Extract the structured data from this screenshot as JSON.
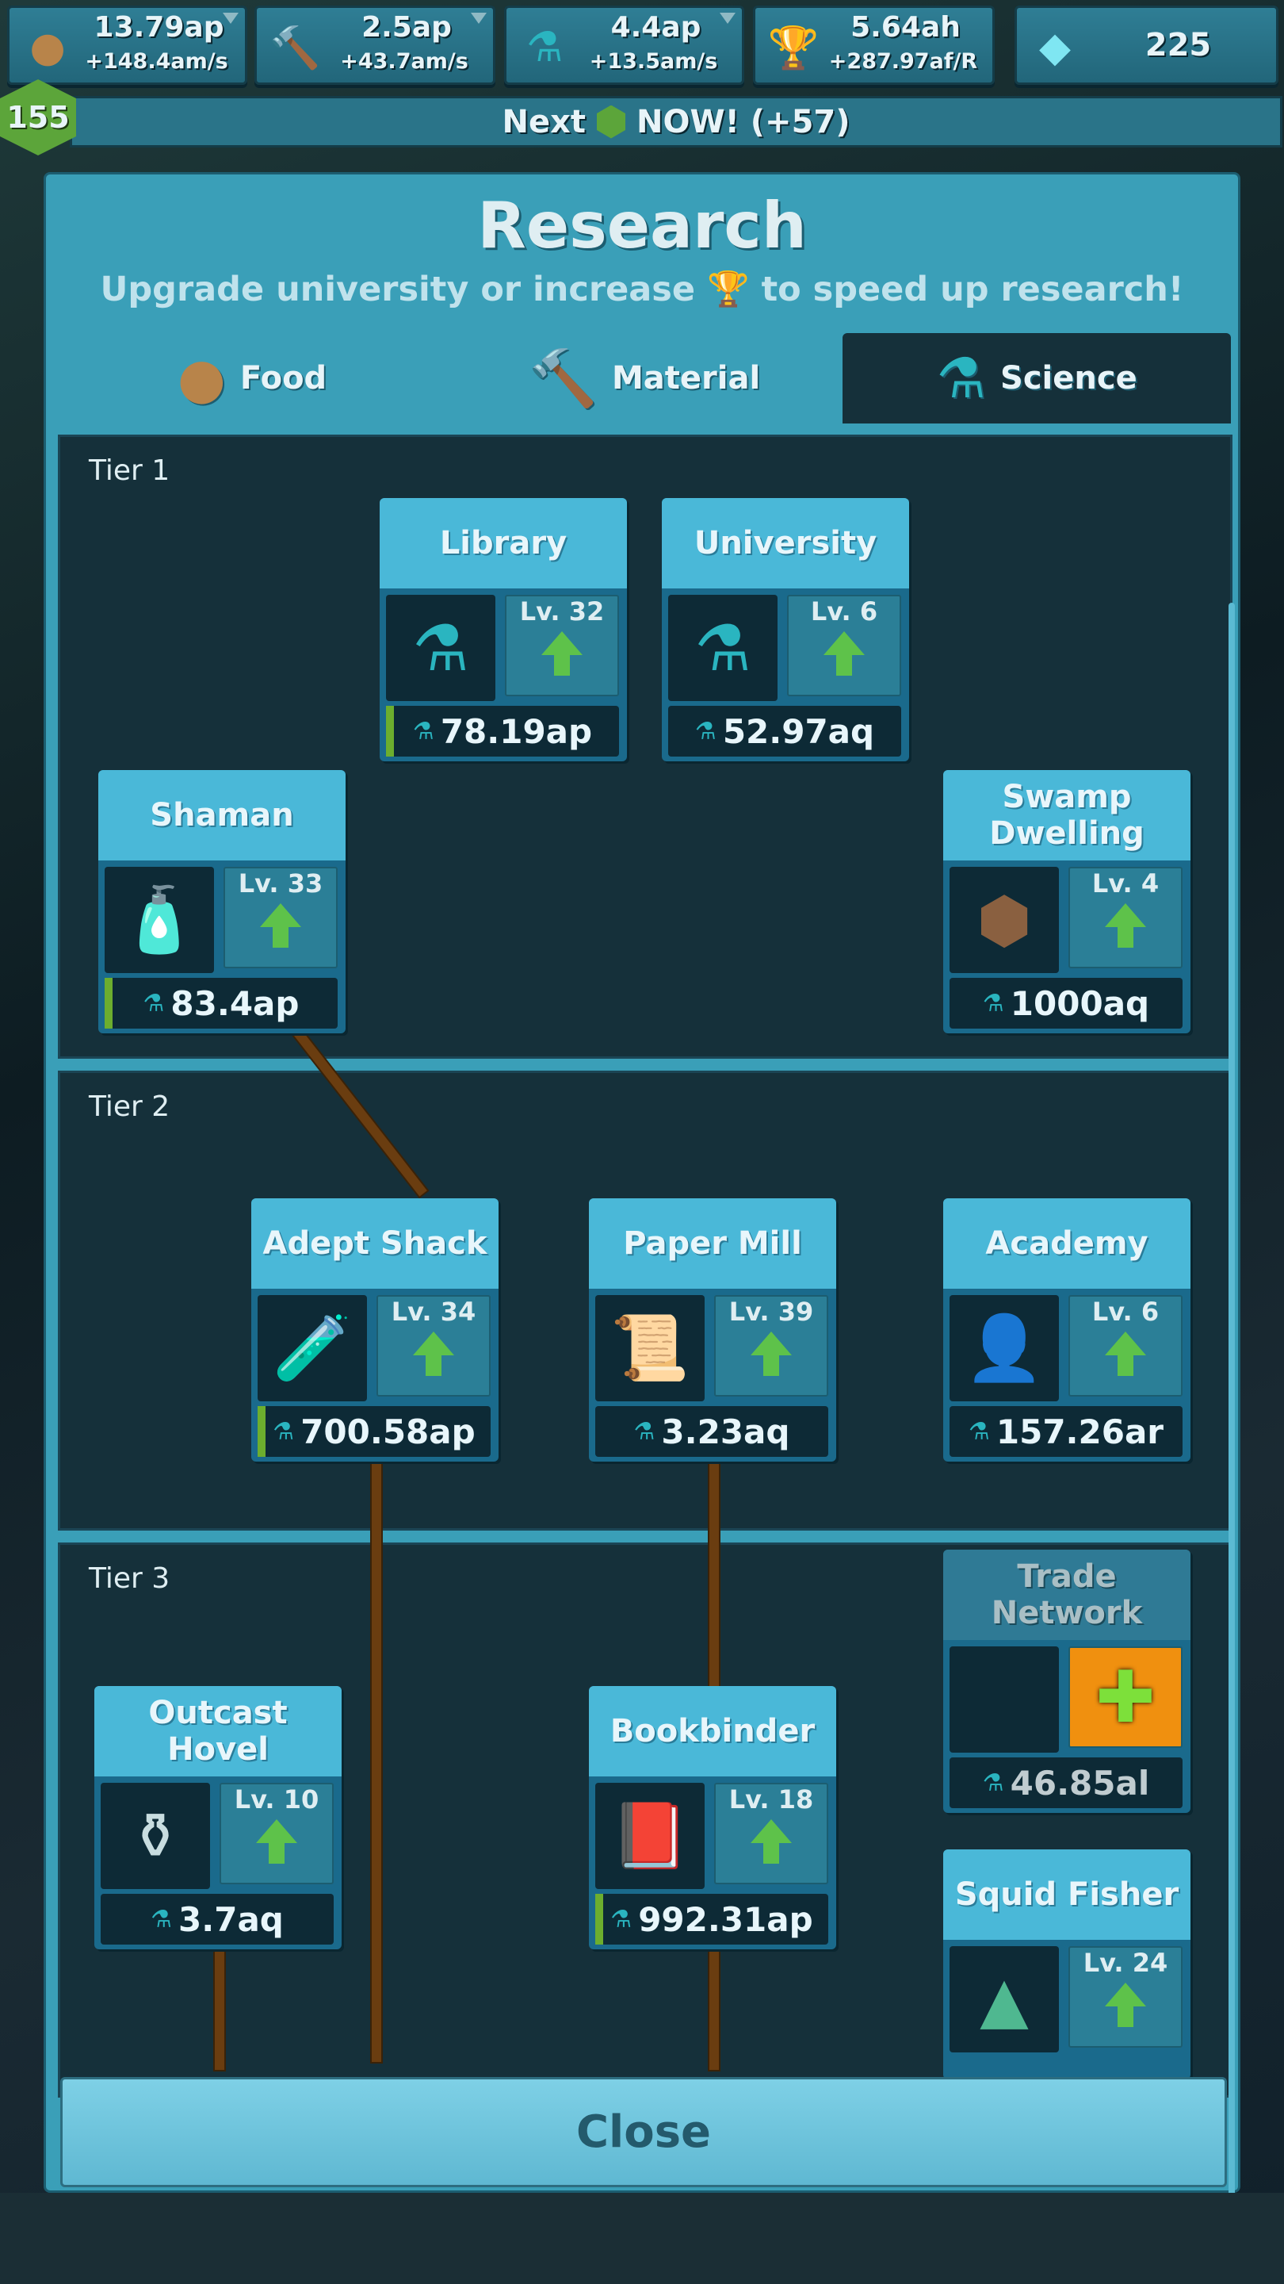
{
  "resources": [
    {
      "name": "food",
      "icon": "food-sack-icon",
      "value": "13.79ap",
      "rate": "+148.4am/s",
      "dropdown": true
    },
    {
      "name": "material",
      "icon": "hammer-icon",
      "value": "2.5ap",
      "rate": "+43.7am/s",
      "dropdown": true
    },
    {
      "name": "science",
      "icon": "flask-icon",
      "value": "4.4ap",
      "rate": "+13.5am/s",
      "dropdown": true
    },
    {
      "name": "chalice",
      "icon": "chalice-icon",
      "value": "5.64ah",
      "rate": "+287.97af/R",
      "dropdown": false
    },
    {
      "name": "gems",
      "icon": "gem-icon",
      "value": "225",
      "rate": "",
      "dropdown": false
    }
  ],
  "level": "155",
  "next": {
    "prefix": "Next",
    "suffix": "NOW! (+57)"
  },
  "research": {
    "title": "Research",
    "subtitle_a": "Upgrade university or increase",
    "subtitle_b": "to speed up research!",
    "tabs": [
      {
        "label": "Food",
        "icon": "food-sack-icon"
      },
      {
        "label": "Material",
        "icon": "hammer-icon"
      },
      {
        "label": "Science",
        "icon": "flask-icon",
        "active": true
      }
    ],
    "tiers": [
      "Tier 1",
      "Tier 2",
      "Tier 3"
    ],
    "buildings": [
      {
        "name": "Library",
        "level": "Lv. 32",
        "cost": "78.19ap",
        "icon": "flask-icon",
        "progress": true
      },
      {
        "name": "University",
        "level": "Lv. 6",
        "cost": "52.97aq",
        "icon": "flask-icon",
        "progress": false
      },
      {
        "name": "Shaman",
        "level": "Lv. 33",
        "cost": "83.4ap",
        "icon": "potion-bottle-icon",
        "progress": true
      },
      {
        "name": "Swamp Dwelling",
        "level": "Lv. 4",
        "cost": "1000aq",
        "icon": "hut-roof-icon",
        "progress": false
      },
      {
        "name": "Adept Shack",
        "level": "Lv. 34",
        "cost": "700.58ap",
        "icon": "test-tube-icon",
        "progress": true
      },
      {
        "name": "Paper Mill",
        "level": "Lv. 39",
        "cost": "3.23aq",
        "icon": "scroll-icon",
        "progress": false
      },
      {
        "name": "Academy",
        "level": "Lv. 6",
        "cost": "157.26ar",
        "icon": "scholar-icon",
        "progress": false
      },
      {
        "name": "Trade Network",
        "level": "",
        "cost": "46.85al",
        "icon": "plus-icon",
        "progress": false,
        "locked": true
      },
      {
        "name": "Outcast Hovel",
        "level": "Lv. 10",
        "cost": "3.7aq",
        "icon": "jar-icon",
        "progress": false
      },
      {
        "name": "Bookbinder",
        "level": "Lv. 18",
        "cost": "992.31ap",
        "icon": "book-icon",
        "progress": true
      },
      {
        "name": "Squid Fisher",
        "level": "Lv. 24",
        "cost": "",
        "icon": "pile-icon",
        "progress": false
      }
    ],
    "close": "Close"
  },
  "colors": {
    "panel": "#3a9fb8",
    "tier_bg": "#15303a",
    "header": "#4ab8d8",
    "upgrade_arrow": "#5ec24a",
    "unlock": "#f0900f"
  }
}
